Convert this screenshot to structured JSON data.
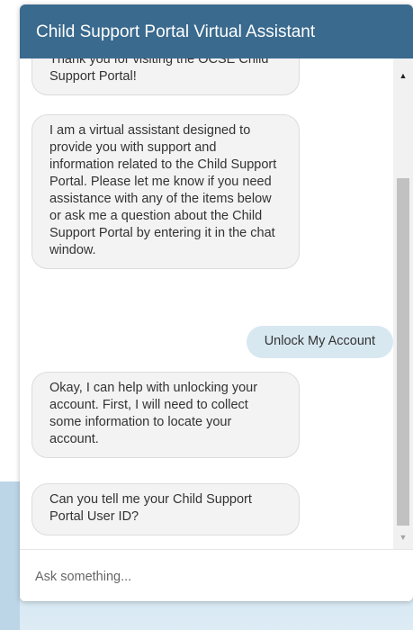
{
  "header": {
    "title": "Child Support Portal Virtual Assistant"
  },
  "messages": [
    {
      "sender": "bot",
      "text": "Thank you for visiting the OCSE Child Support Portal!"
    },
    {
      "sender": "bot",
      "text": "I am a virtual assistant designed to provide you with support and information related to the Child Support Portal. Please let me know if you need assistance with any of the items below or ask me a question about the Child Support Portal by entering it in the chat window."
    },
    {
      "sender": "user",
      "text": "Unlock My Account"
    },
    {
      "sender": "bot",
      "text": "Okay, I can help with unlocking your account. First, I will need to collect some information to locate your account."
    },
    {
      "sender": "bot",
      "text": "Can you tell me your Child Support Portal User ID?"
    }
  ],
  "input": {
    "placeholder": "Ask something..."
  },
  "scrollbar": {
    "up_icon": "▲",
    "down_icon": "▼"
  },
  "colors": {
    "header_bg": "#3a6a8e",
    "bot_bubble": "#f3f3f3",
    "user_bubble": "#d8e8f1"
  }
}
